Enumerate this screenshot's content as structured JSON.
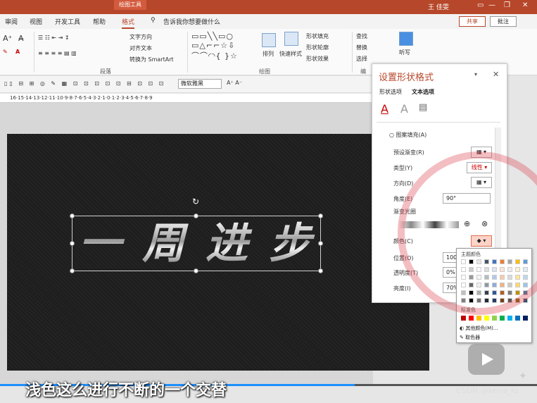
{
  "window": {
    "context_tab": "绘图工具",
    "user": "王 佳雯"
  },
  "tabs": [
    "审阅",
    "视图",
    "开发工具",
    "帮助",
    "格式"
  ],
  "active_tab": "格式",
  "tellme": "告诉我你想要做什么",
  "share_label": "共享",
  "comment_label": "批注",
  "ribbon": {
    "text_direction": "文字方向",
    "align_text": "对齐文本",
    "smartart": "转换为 SmartArt",
    "paragraph_group": "段落",
    "arrange": "排列",
    "quick_styles": "快速样式",
    "shape_fill": "形状填充",
    "shape_outline": "形状轮廓",
    "shape_effects": "形状效果",
    "drawing_group": "绘图",
    "find": "查找",
    "replace": "替换",
    "select": "选择",
    "edit_group": "编",
    "dictate": "听写"
  },
  "font_name": "微软雅黑",
  "ruler_text": "16·15·14·13·12·11·10·9·8·7·6·5·4·3·2·1·0·1·2·3·4·5·6·7·8·9",
  "slide_text": "一周进步",
  "pane": {
    "title": "设置形状格式",
    "tab_shape": "形状选项",
    "tab_text": "文本选项",
    "radial_fill": "图案填充(A)",
    "preset_gradient": "预设渐变(R)",
    "type_label": "类型(Y)",
    "type_value": "线性",
    "direction_label": "方向(D)",
    "angle_label": "角度(E)",
    "angle_value": "90°",
    "stops_label": "渐变光圈",
    "color_label": "颜色(C)",
    "position_label": "位置(O)",
    "position_value": "100%",
    "transparency_label": "透明度(T)",
    "transparency_value": "0%",
    "brightness_label": "亮度(I)",
    "brightness_value": "70%"
  },
  "popup": {
    "theme_colors": "主题颜色",
    "standard_colors": "标准色",
    "more_colors": "其他颜色(M)...",
    "eyedropper": "取色器",
    "theme_row": [
      "#ffffff",
      "#000000",
      "#e7e6e6",
      "#44546a",
      "#4472c4",
      "#ed7d31",
      "#a5a5a5",
      "#ffc000",
      "#5b9bd5"
    ],
    "standard_row": [
      "#c00000",
      "#ff0000",
      "#ffc000",
      "#ffff00",
      "#92d050",
      "#00b050",
      "#00b0f0",
      "#0070c0",
      "#002060"
    ]
  },
  "subtitle": "浅色这么进行不断的一个交替",
  "watermark": "CSDN @keira_lu",
  "video_progress": 0.66
}
